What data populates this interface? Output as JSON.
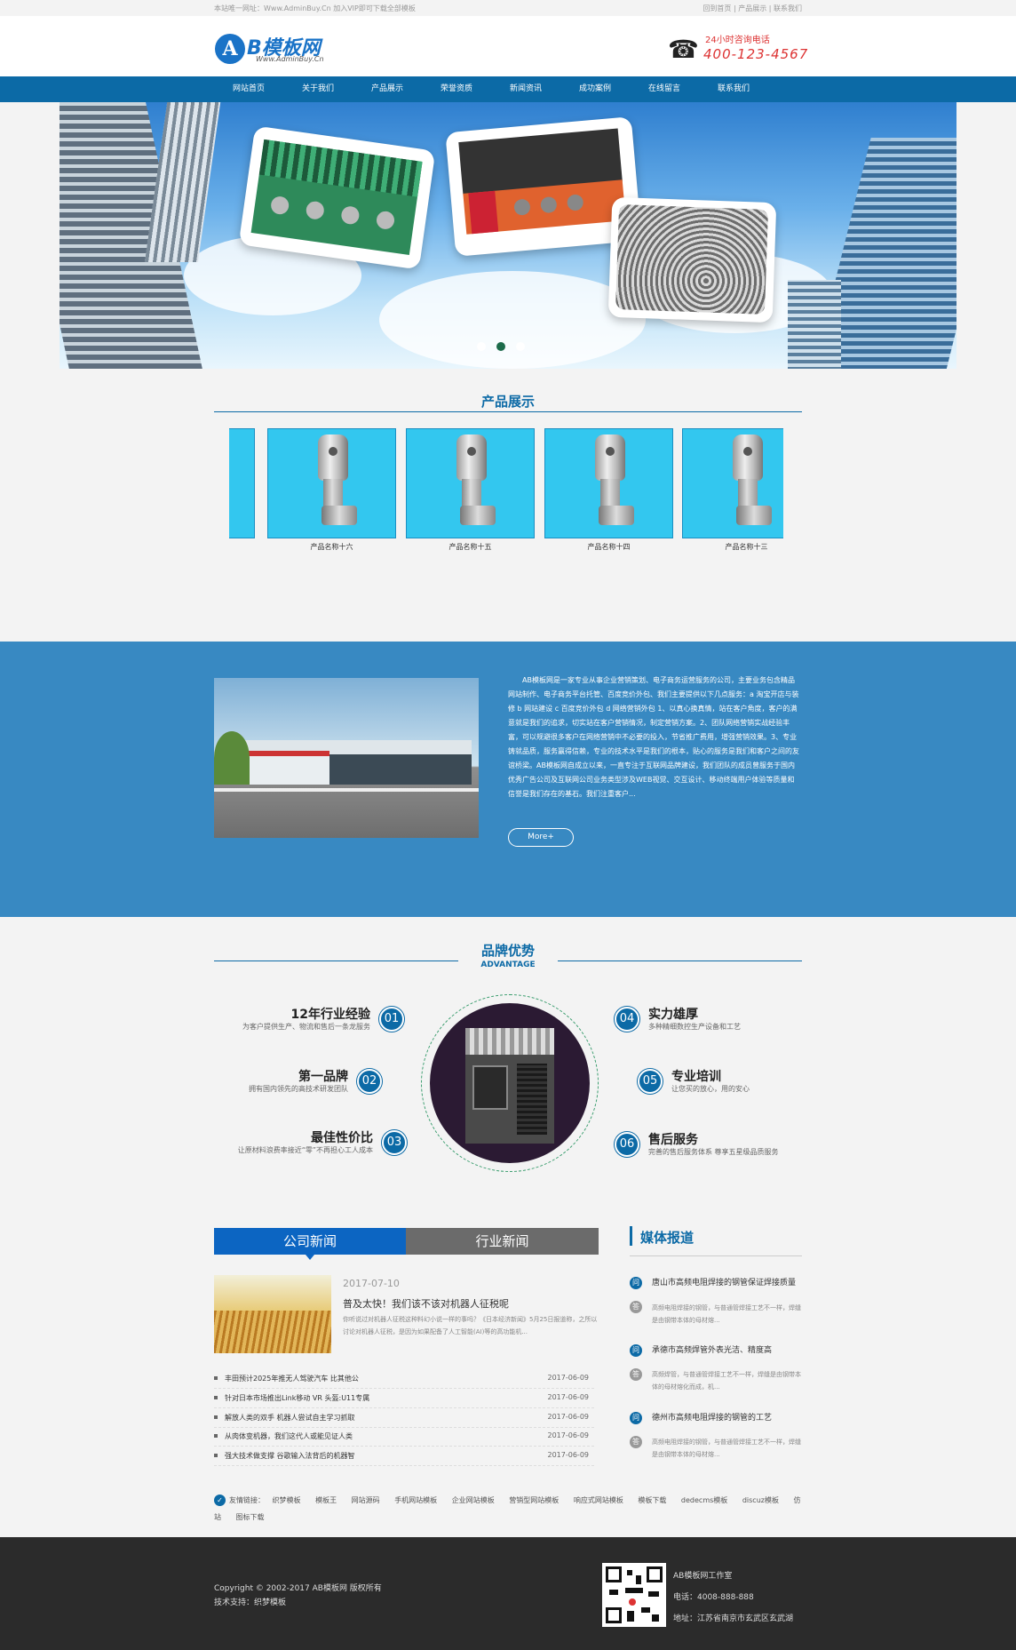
{
  "topbar": {
    "notice": "本站唯一网址：Www.AdminBuy.Cn 加入VIP即可下载全部模板",
    "links": [
      "回到首页",
      "产品展示",
      "联系我们"
    ]
  },
  "header": {
    "logo_mark": "A",
    "logo_text": "B模板网",
    "logo_url": "Www.AdminBuy.Cn",
    "hotline_label": "24小时咨询电话",
    "hotline_number": "400-123-4567"
  },
  "nav": {
    "items": [
      "网站首页",
      "关于我们",
      "产品展示",
      "荣誉资质",
      "新闻资讯",
      "成功案例",
      "在线留言",
      "联系我们"
    ]
  },
  "products": {
    "title": "产品展示",
    "items": [
      "产品名称十六",
      "产品名称十五",
      "产品名称十四",
      "产品名称十三"
    ]
  },
  "about": {
    "text": "AB模板网是一家专业从事企业营销策划、电子商务运营服务的公司，主要业务包含精品网站制作、电子商务平台托管、百度竞价外包、我们主要提供以下几点服务：a 淘宝开店与装修 b 网站建设 c 百度竞价外包 d 网络营销外包 1、以真心换真情，站在客户角度，客户的满意就是我们的追求，切实站在客户营销情况，制定营销方案。2、团队网络营销实战经验丰富，可以规避很多客户在网络营销中不必要的投入，节省推广费用，增强营销效果。3、专业铸就品质，服务赢得信赖，专业的技术水平是我们的根本，贴心的服务是我们和客户之间的友谊桥梁。AB模板网自成立以来，一直专注于互联网品牌建设，我们团队的成员曾服务于国内优秀广告公司及互联网公司业务类型涉及WEB视觉、交互设计、移动终端用户体验等质量和信誉是我们存在的基石。我们注重客户...",
    "more": "More+"
  },
  "advantage": {
    "title": "品牌优势",
    "subtitle": "ADVANTAGE",
    "items": [
      {
        "num": "01",
        "title": "12年行业经验",
        "desc": "为客户提供生产、物流和售后一条龙服务"
      },
      {
        "num": "02",
        "title": "第一品牌",
        "desc": "拥有国内领先的高技术研发团队"
      },
      {
        "num": "03",
        "title": "最佳性价比",
        "desc": "让原材料浪费率接近“零”不再担心工人成本"
      },
      {
        "num": "04",
        "title": "实力雄厚",
        "desc": "多种精细数控生产设备和工艺"
      },
      {
        "num": "05",
        "title": "专业培训",
        "desc": "让您买的放心，用的安心"
      },
      {
        "num": "06",
        "title": "售后服务",
        "desc": "完善的售后服务体系 尊享五星级品质服务"
      }
    ]
  },
  "news": {
    "tab_company": "公司新闻",
    "tab_industry": "行业新闻",
    "featured": {
      "date": "2017-07-10",
      "title": "普及太快！我们该不该对机器人征税呢",
      "summary": "你听说过对机器人征税这种料幻小说一样的事吗？《日本经济新闻》5月25日报道称，之所以讨论对机器人征税，是因为如果配备了人工智能(AI)等的高功能机..."
    },
    "list": [
      {
        "title": "丰田预计2025年推无人驾驶汽车 比其他公",
        "date": "2017-06-09"
      },
      {
        "title": "针对日本市场推出Link移动 VR 头盔:U11专属",
        "date": "2017-06-09"
      },
      {
        "title": "解放人类的双手 机器人尝试自主学习抓取",
        "date": "2017-06-09"
      },
      {
        "title": "从肉体变机器，我们这代人或能见证人类",
        "date": "2017-06-09"
      },
      {
        "title": "强大技术做支撑 谷歌输入法背后的机器智",
        "date": "2017-06-09"
      }
    ]
  },
  "media": {
    "title": "媒体报道",
    "q_mark": "问",
    "a_mark": "答",
    "items": [
      {
        "q": "唐山市高频电阻焊接的钢管保证焊接质量",
        "a": "高频电阻焊接的钢管，与普通管焊接工艺不一样，焊缝是由钢带本体的母材熔..."
      },
      {
        "q": "承德市高频焊管外表光洁、精度高",
        "a": "高频焊管，与普通管焊接工艺不一样，焊缝是由钢带本体的母材熔化而成，机..."
      },
      {
        "q": "德州市高频电阻焊接的钢管的工艺",
        "a": "高频电阻焊接的钢管，与普通管焊接工艺不一样，焊缝是由钢带本体的母材熔..."
      }
    ]
  },
  "friend_links": {
    "label": "友情链接：",
    "items": [
      "织梦模板",
      "模板王",
      "网站源码",
      "手机网站模板",
      "企业网站模板",
      "营销型网站模板",
      "响应式网站模板",
      "模板下载",
      "dedecms模板",
      "discuz模板",
      "仿站",
      "图标下载"
    ]
  },
  "footer": {
    "copyright": "Copyright © 2002-2017 AB模板网 版权所有",
    "support": "技术支持：织梦模板",
    "company": "AB模板网工作室",
    "phone": "电话：4008-888-888",
    "address": "地址：江苏省南京市玄武区玄武湖"
  },
  "colors": {
    "primary": "#0c6aa6",
    "about_bg": "#3889c2",
    "tab_active": "#0c65c2",
    "tab_inactive": "#6b6b6b",
    "footer_bg": "#2b2b2b",
    "hotline": "#dd3333"
  }
}
